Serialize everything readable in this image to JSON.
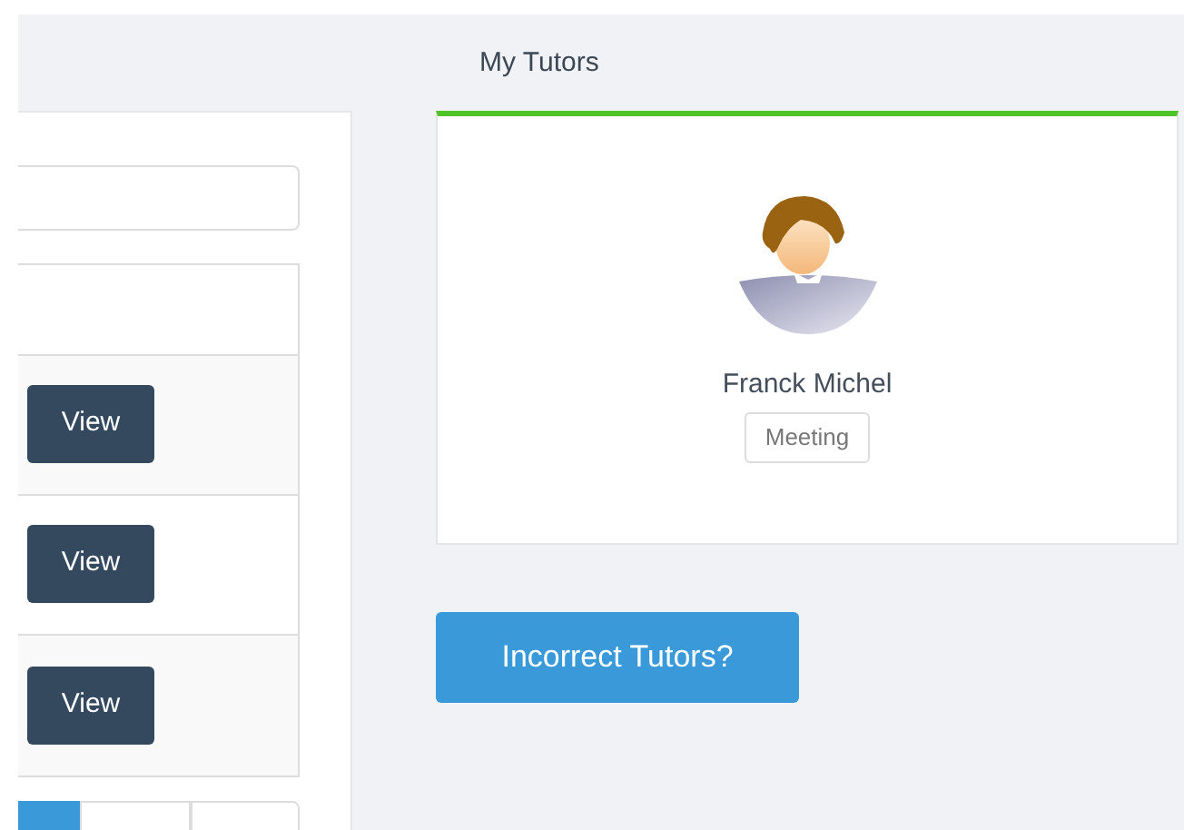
{
  "section_title": "My Tutors",
  "table": {
    "rows": [
      {
        "action": "View"
      },
      {
        "action": "View"
      },
      {
        "action": "View"
      }
    ]
  },
  "pagination": [
    {
      "selected": true
    },
    {
      "selected": false
    },
    {
      "selected": false
    }
  ],
  "tutors": [
    {
      "name": "Franck Michel",
      "tag": "Meeting"
    }
  ],
  "button": "Incorrect Tutors?"
}
